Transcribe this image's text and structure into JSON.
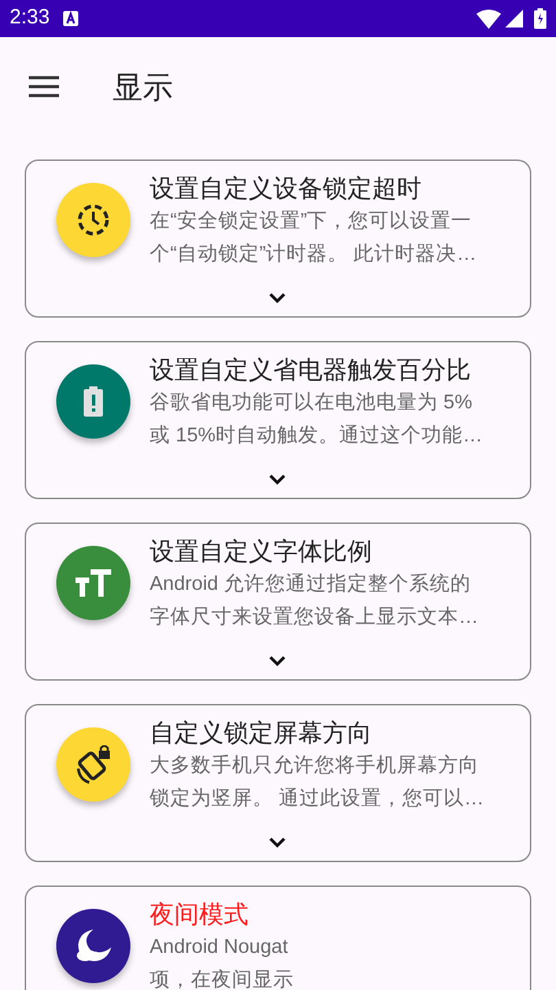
{
  "status_bar": {
    "time": "2:33"
  },
  "app_bar": {
    "title": "显示"
  },
  "cards": [
    {
      "kind": "clock",
      "color": "#fdd835",
      "title": "设置自定义设备锁定超时",
      "highlighted": false,
      "lines": [
        "在“安全锁定设置”下，您可以设置一",
        "个“自动锁定”计时器。 此计时器决…"
      ]
    },
    {
      "kind": "battery",
      "color": "#00796b",
      "title": "设置自定义省电器触发百分比",
      "highlighted": false,
      "lines": [
        "谷歌省电功能可以在电池电量为 5%",
        "或 15%时自动触发。通过这个功能…"
      ]
    },
    {
      "kind": "text",
      "color": "#388e3c",
      "title": "设置自定义字体比例",
      "highlighted": false,
      "lines": [
        "Android 允许您通过指定整个系统的",
        "字体尺寸来设置您设备上显示文本…"
      ]
    },
    {
      "kind": "rotation",
      "color": "#fdd835",
      "title": "自定义锁定屏幕方向",
      "highlighted": false,
      "lines": [
        "大多数手机只允许您将手机屏幕方向",
        "锁定为竖屏。 通过此设置，您可以…"
      ]
    },
    {
      "kind": "moon",
      "color": "#311b92",
      "title": "夜间模式",
      "highlighted": true,
      "lines": [
        "Android Nougat",
        "项，在夜间显示"
      ]
    }
  ]
}
